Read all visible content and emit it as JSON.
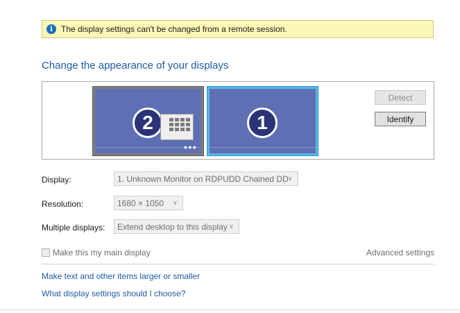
{
  "infobar": {
    "icon": "info-icon",
    "message": "The display settings can't be changed from a remote session."
  },
  "title": "Change the appearance of your displays",
  "preview": {
    "monitor2": {
      "number": "2"
    },
    "monitor1": {
      "number": "1"
    },
    "detect_label": "Detect",
    "identify_label": "Identify"
  },
  "form": {
    "display_label": "Display:",
    "display_value": "1. Unknown Monitor on RDPUDD Chained DD",
    "resolution_label": "Resolution:",
    "resolution_value": "1680 × 1050",
    "multiple_label": "Multiple displays:",
    "multiple_value": "Extend desktop to this display"
  },
  "main_display_label": "Make this my main display",
  "advanced_label": "Advanced settings",
  "links": {
    "text_size": "Make text and other items larger or smaller",
    "help": "What display settings should I choose?"
  },
  "colors": {
    "accent": "#1e5aa8",
    "infobar_bg": "#fcf7b6",
    "monitor_screen": "#5f6fb4",
    "selected_border": "#57b9ea"
  }
}
